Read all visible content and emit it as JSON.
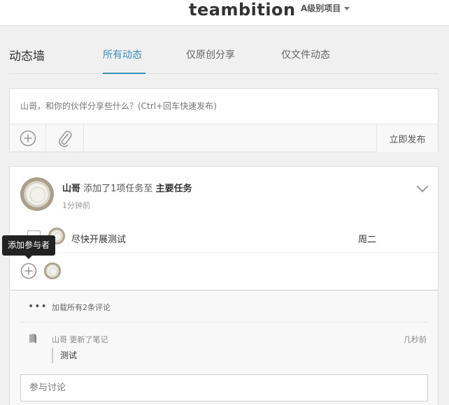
{
  "header": {
    "brand": "teambition",
    "project_label": "A级别项目"
  },
  "wall": {
    "title": "动态墙",
    "tabs": [
      {
        "label": "所有动态"
      },
      {
        "label": "仅原创分享"
      },
      {
        "label": "仅文件动态"
      }
    ]
  },
  "composer": {
    "placeholder": "山哥，和你的伙伴分享些什么？(Ctrl+回车快速发布)",
    "publish_label": "立即发布"
  },
  "activity": {
    "user": "山哥",
    "action": "添加了1项任务至",
    "target": "主要任务",
    "time": "1分钟前",
    "task": {
      "name": "尽快开展测试",
      "due": "周二"
    },
    "tooltip": "添加参与者"
  },
  "comments": {
    "load_more": "加载所有2条评论",
    "note": {
      "text": "山哥 更新了笔记",
      "time": "几秒前",
      "quote": "测试"
    },
    "input_placeholder": "参与讨论"
  },
  "colors": {
    "accent": "#3a8fb7",
    "tooltip_bg": "#222222"
  }
}
